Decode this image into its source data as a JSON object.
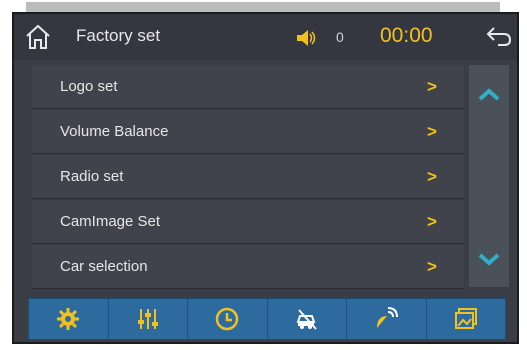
{
  "header": {
    "title": "Factory set",
    "volume": "0",
    "clock": "00:00"
  },
  "menu": {
    "items": [
      {
        "label": "Logo set",
        "chevron": ">"
      },
      {
        "label": "Volume Balance",
        "chevron": ">"
      },
      {
        "label": "Radio set",
        "chevron": ">"
      },
      {
        "label": "CamImage Set",
        "chevron": ">"
      },
      {
        "label": "Car selection",
        "chevron": ">"
      }
    ]
  },
  "icons": {
    "home": "home-icon",
    "volume": "speaker-icon",
    "back": "back-arrow-icon",
    "scroll_up": "chevron-up-icon",
    "scroll_down": "chevron-down-icon",
    "tabs": [
      "gear-icon",
      "equalizer-icon",
      "clock-icon",
      "car-off-icon",
      "satellite-dish-icon",
      "gallery-icon"
    ]
  },
  "colors": {
    "accent": "#f2c11f",
    "tabbar": "#2d6a9e",
    "scroll_arrow": "#2fb0c9"
  }
}
